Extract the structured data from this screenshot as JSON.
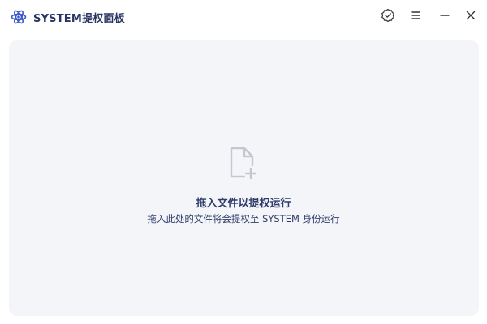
{
  "window": {
    "title": "SYSTEM提权面板",
    "logo_icon": "atom-logo-icon",
    "controls": {
      "verify_icon": "badge-check-icon",
      "menu_icon": "hamburger-menu-icon",
      "minimize_icon": "minimize-icon",
      "close_icon": "close-icon"
    }
  },
  "dropzone": {
    "icon": "file-plus-icon",
    "title": "拖入文件以提权运行",
    "subtitle": "拖入此处的文件将会提权至 SYSTEM 身份运行"
  },
  "colors": {
    "accent": "#2f3c6b",
    "logo": "#3b57c9",
    "dropzone_bg": "#f4f5f8",
    "icon_gray": "#c4c7cf"
  }
}
